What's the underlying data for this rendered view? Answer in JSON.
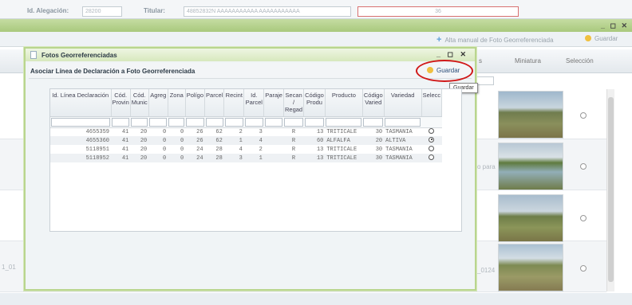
{
  "topbar": {
    "alegacion_label": "Id. Alegación:",
    "alegacion_value": "28200",
    "titular_label": "Titular:",
    "titular_value": "48852832N  AAAAAAAAAAA AAAAAAAAAAA",
    "extra_value": "36"
  },
  "window_controls": "_ ◻ ✕",
  "bg_toolbar": {
    "add_label": "Alta manual de Foto Georreferenciada",
    "save_label": "Guardar"
  },
  "bg_table": {
    "col_ns": "s",
    "col_thumb": "Miniatura",
    "col_select": "Selección"
  },
  "bg_fragments": {
    "left_row4": "1_01",
    "mid_row2": "o para",
    "mid_row4": "_0124"
  },
  "modal": {
    "title": "Fotos Georreferenciadas",
    "controls": "_ ◻ ✕",
    "subtitle": "Asociar Línea de Declaración a Foto Georreferenciada",
    "save_label": "Guardar",
    "tooltip": "Guardar"
  },
  "grid": {
    "headers": [
      "Id. Línea Declaración",
      "Cód. Provin",
      "Cód. Munic",
      "Agreg",
      "Zona",
      "Polígo",
      "Parcel",
      "Recint",
      "Id. Parcel",
      "Paraje",
      "Secan / Regad",
      "Código Produ",
      "Producto",
      "Código Varied",
      "Variedad",
      "Selecc"
    ],
    "rows": [
      [
        "4655359",
        "41",
        "20",
        "0",
        "0",
        "26",
        "62",
        "2",
        "3",
        "",
        "R",
        "13",
        "TRITICALE",
        "30",
        "TASMANIA"
      ],
      [
        "4655360",
        "41",
        "20",
        "0",
        "0",
        "26",
        "62",
        "1",
        "4",
        "",
        "R",
        "60",
        "ALFALFA",
        "20",
        "ALTIVA"
      ],
      [
        "5118951",
        "41",
        "20",
        "0",
        "0",
        "24",
        "28",
        "4",
        "2",
        "",
        "R",
        "13",
        "TRITICALE",
        "30",
        "TASMANIA"
      ],
      [
        "5118952",
        "41",
        "20",
        "0",
        "0",
        "24",
        "28",
        "3",
        "1",
        "",
        "R",
        "13",
        "TRITICALE",
        "30",
        "TASMANIA"
      ]
    ],
    "selected": [
      false,
      true,
      false,
      false
    ]
  },
  "colors": {
    "accent_green": "#b9d58e",
    "highlight_red": "#d01818",
    "link_blue": "#2d4f7a"
  },
  "icons": {
    "title": "document-icon",
    "save": "save-icon",
    "add": "plus-icon"
  }
}
